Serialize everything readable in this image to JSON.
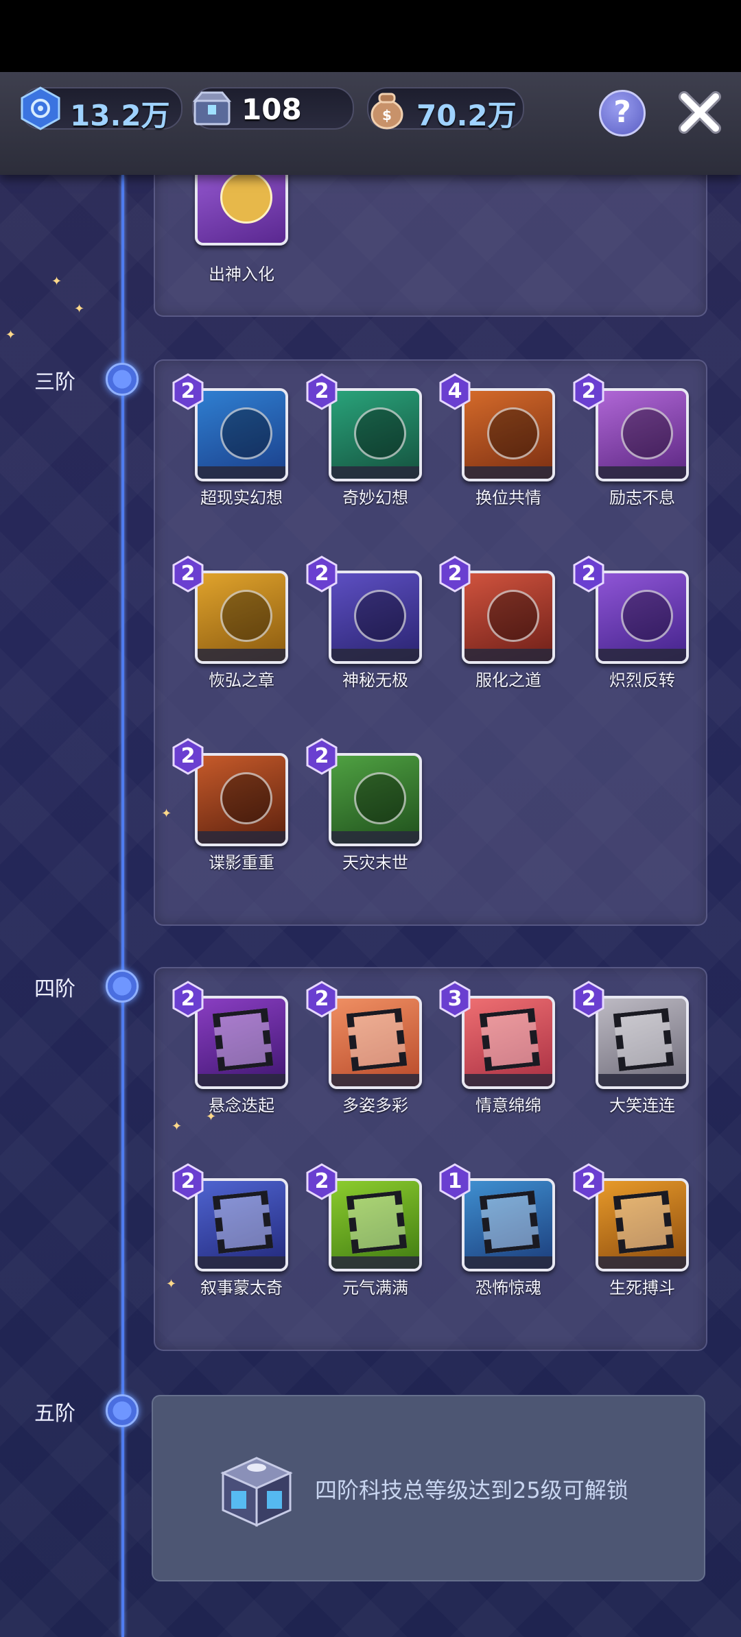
{
  "resources": [
    {
      "icon": "gem-tech-icon",
      "value": "13.2万",
      "blue": true
    },
    {
      "icon": "chest-icon",
      "value": "108",
      "blue": false
    },
    {
      "icon": "money-bag-icon",
      "value": "70.2万",
      "blue": true
    }
  ],
  "prev_item": {
    "name": "出神入化"
  },
  "tiers": [
    {
      "label": "三阶",
      "items": [
        {
          "name": "超现实幻想",
          "level": "2",
          "color": "#2f7fd1",
          "color2": "#1b3f8a"
        },
        {
          "name": "奇妙幻想",
          "level": "2",
          "color": "#29a37a",
          "color2": "#15513e"
        },
        {
          "name": "换位共情",
          "level": "4",
          "color": "#d46a2a",
          "color2": "#7a2e12"
        },
        {
          "name": "励志不息",
          "level": "2",
          "color": "#b067d6",
          "color2": "#5a2680"
        },
        {
          "name": "恢弘之章",
          "level": "2",
          "color": "#e0a32c",
          "color2": "#8a5a10"
        },
        {
          "name": "神秘无极",
          "level": "2",
          "color": "#5d4fc2",
          "color2": "#2a2470"
        },
        {
          "name": "服化之道",
          "level": "2",
          "color": "#d0533e",
          "color2": "#6e1f18"
        },
        {
          "name": "炽烈反转",
          "level": "2",
          "color": "#8f55d6",
          "color2": "#43238a"
        },
        {
          "name": "谍影重重",
          "level": "2",
          "color": "#c65a2a",
          "color2": "#5a200e"
        },
        {
          "name": "天灾末世",
          "level": "2",
          "color": "#4fa142",
          "color2": "#1f4f1c"
        }
      ]
    },
    {
      "label": "四阶",
      "items": [
        {
          "name": "悬念迭起",
          "level": "2",
          "color": "#8a3ec2",
          "color2": "#3f1670"
        },
        {
          "name": "多姿多彩",
          "level": "2",
          "color": "#ef8f63",
          "color2": "#b84a2a"
        },
        {
          "name": "情意绵绵",
          "level": "3",
          "color": "#ee6f72",
          "color2": "#a82f42"
        },
        {
          "name": "大笑连连",
          "level": "2",
          "color": "#bdbac3",
          "color2": "#6d6a78"
        },
        {
          "name": "叙事蒙太奇",
          "level": "2",
          "color": "#4f64d0",
          "color2": "#22287a"
        },
        {
          "name": "元气满满",
          "level": "2",
          "color": "#8ccc2e",
          "color2": "#3f7a12"
        },
        {
          "name": "恐怖惊魂",
          "level": "1",
          "color": "#3f8fd0",
          "color2": "#1b3c7a"
        },
        {
          "name": "生死搏斗",
          "level": "2",
          "color": "#e79a2a",
          "color2": "#8a4a0e"
        }
      ]
    },
    {
      "label": "五阶",
      "locked_message": "四阶科技总等级达到25级可解锁"
    }
  ]
}
